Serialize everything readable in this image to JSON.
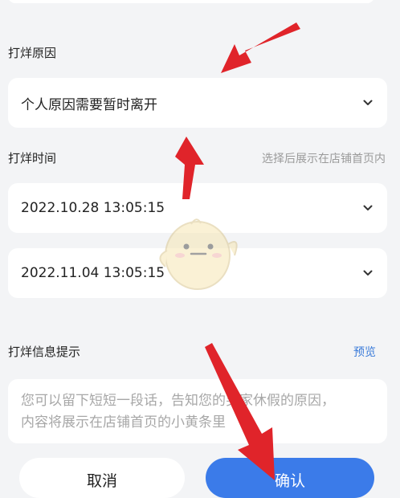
{
  "reason": {
    "label": "打烊原因",
    "value": "个人原因需要暂时离开"
  },
  "time": {
    "label": "打烊时间",
    "hint": "选择后展示在店铺首页内",
    "start": "2022.10.28 13:05:15",
    "end": "2022.11.04 13:05:15"
  },
  "info": {
    "label": "打烊信息提示",
    "preview": "预览",
    "placeholder_line1": "您可以留下短短一段话，告知您的买家休假的原因，",
    "placeholder_line2": "内容将展示在店铺首页的小黄条里"
  },
  "actions": {
    "cancel": "取消",
    "confirm": "确认"
  },
  "colors": {
    "accent": "#3b7be9",
    "annotation": "#e0242a",
    "background": "#f3f4f6"
  },
  "icons": {
    "dropdown": "chevron-down-icon",
    "arrows": "red-arrow-annotation",
    "mascot": "chick-mascot-watermark"
  }
}
